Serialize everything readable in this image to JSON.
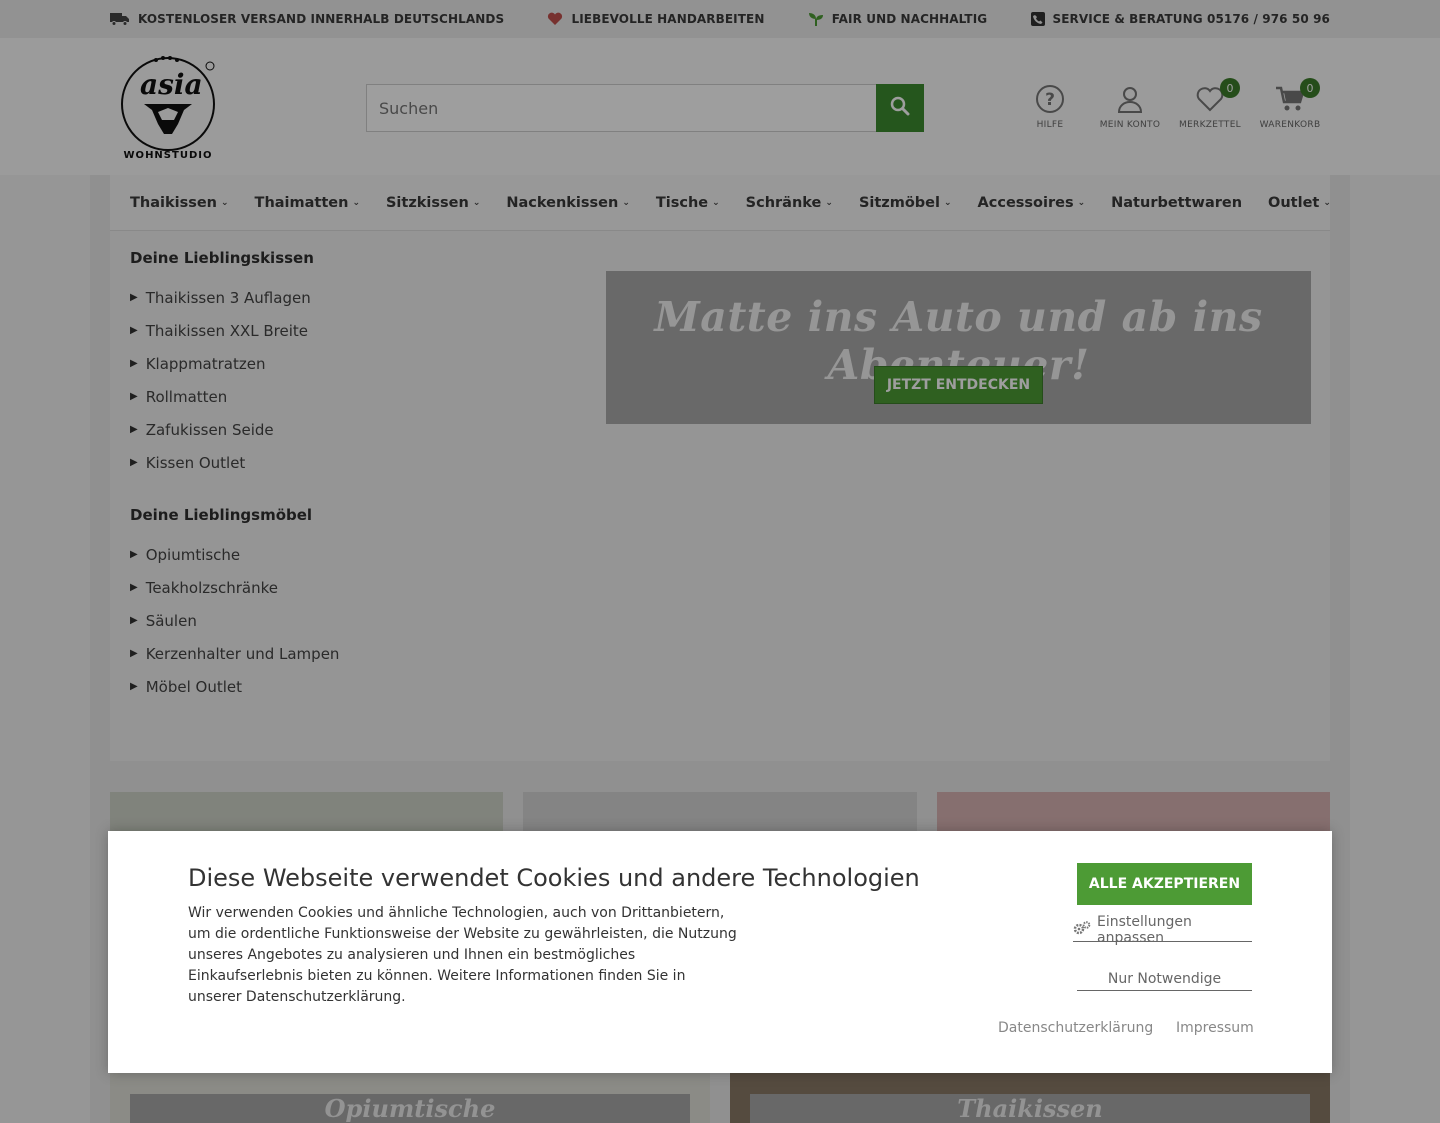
{
  "topbar": {
    "usps": [
      {
        "icon": "truck-icon",
        "text": "KOSTENLOSER VERSAND INNERHALB DEUTSCHLANDS"
      },
      {
        "icon": "heart-icon",
        "text": "LIEBEVOLLE HANDARBEITEN"
      },
      {
        "icon": "sprout-icon",
        "text": "FAIR UND NACHHALTIG"
      },
      {
        "icon": "phone-icon",
        "text": "SERVICE & BERATUNG 05176 / 976 50 96"
      }
    ]
  },
  "brand": {
    "logo_text": "asia",
    "logo_sub": "WOHNSTUDIO"
  },
  "search": {
    "placeholder": "Suchen"
  },
  "header_icons": {
    "help": "HILFE",
    "account": "MEIN KONTO",
    "wishlist": "MERKZETTEL",
    "wishlist_count": "0",
    "cart": "WARENKORB",
    "cart_count": "0"
  },
  "nav": {
    "items": [
      {
        "label": "Thaikissen",
        "chev": "⌄"
      },
      {
        "label": "Thaimatten",
        "chev": "⌄"
      },
      {
        "label": "Sitzkissen",
        "chev": "⌄"
      },
      {
        "label": "Nackenkissen",
        "chev": "⌄"
      },
      {
        "label": "Tische",
        "chev": "⌄"
      },
      {
        "label": "Schränke",
        "chev": "⌄"
      },
      {
        "label": "Sitzmöbel",
        "chev": "⌄"
      },
      {
        "label": "Accessoires",
        "chev": "⌄"
      },
      {
        "label": "Naturbettwaren",
        "chev": ""
      },
      {
        "label": "Outlet",
        "chev": "⌄"
      }
    ]
  },
  "mega": {
    "group1": {
      "title": "Deine Lieblingskissen",
      "links": [
        "Thaikissen 3 Auflagen",
        "Thaikissen XXL Breite",
        "Klappmatratzen",
        "Rollmatten",
        "Zafukissen Seide",
        "Kissen Outlet"
      ]
    },
    "group2": {
      "title": "Deine Lieblingsmöbel",
      "links": [
        "Opiumtische",
        "Teakholzschränke",
        "Säulen",
        "Kerzenhalter und Lampen",
        "Möbel Outlet"
      ]
    },
    "promo": {
      "title": "Matte ins Auto und ab ins Abenteuer!",
      "button": "JETZT ENTDECKEN"
    }
  },
  "tiles": {
    "captions": [
      "Opiumtische",
      "Thaikissen"
    ]
  },
  "cookie": {
    "title": "Diese Webseite verwendet Cookies und andere Technologien",
    "text": "Wir verwenden Cookies und ähnliche Technologien, auch von Drittanbietern, um die ordentliche Funktionsweise der Website zu gewährleisten, die Nutzung unseres Angebotes zu analysieren und Ihnen ein bestmögliches Einkaufserlebnis bieten zu können. Weitere Informationen finden Sie in unserer Datenschutzerklärung.",
    "accept": "ALLE AKZEPTIEREN",
    "settings": "Einstellungen anpassen",
    "necessary": "Nur Notwendige",
    "privacy": "Datenschutzerklärung",
    "imprint": "Impressum"
  },
  "colors": {
    "accent": "#4d9b35",
    "accent_dark": "#3d7d2a"
  }
}
